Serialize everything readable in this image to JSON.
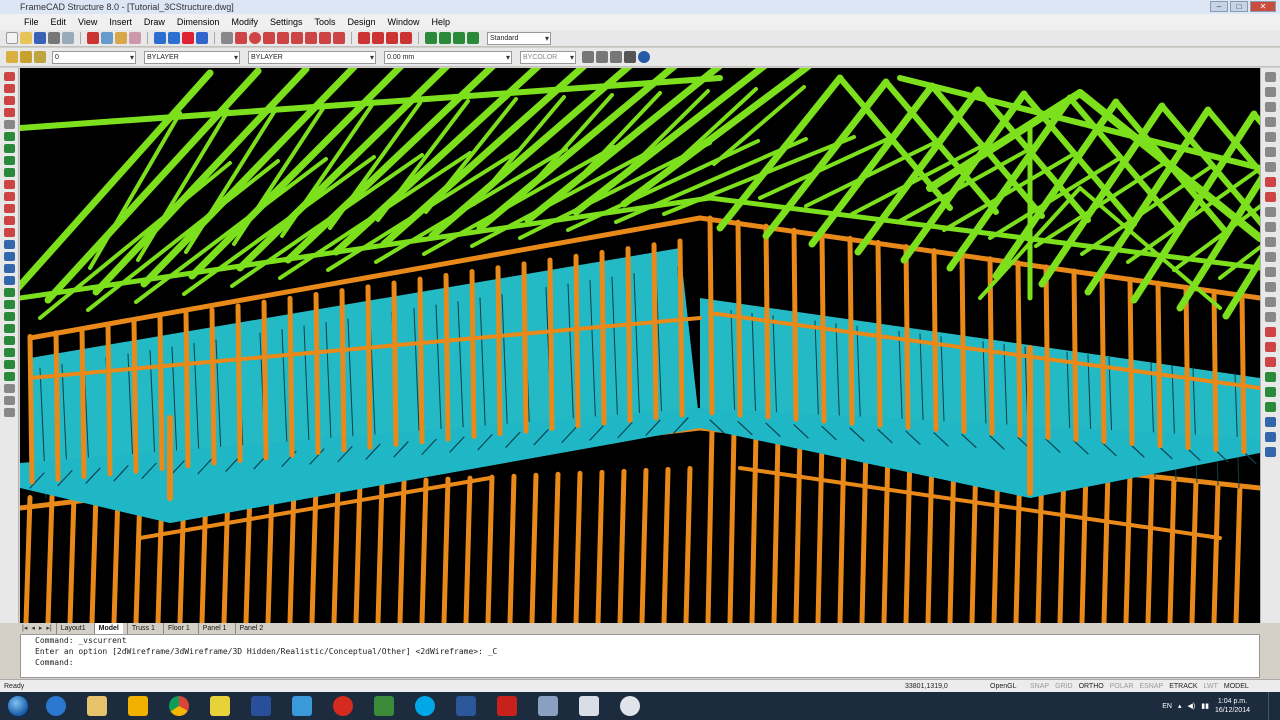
{
  "window": {
    "title": "FrameCAD Structure 8.0 - [Tutorial_3CStructure.dwg]"
  },
  "menu": [
    "File",
    "Edit",
    "View",
    "Insert",
    "Draw",
    "Dimension",
    "Modify",
    "Settings",
    "Tools",
    "Design",
    "Window",
    "Help"
  ],
  "toolbar": {
    "style_combo": "Standard",
    "layer_combo": "0",
    "color_combo": "BYLAYER",
    "linetype_combo": "BYLAYER",
    "lineweight_combo": "0.00 mm",
    "plotstyle_combo": "BYCOLOR"
  },
  "layout_tabs": [
    "Layout1",
    "Model",
    "Truss 1",
    "Floor 1",
    "Panel 1",
    "Panel 2"
  ],
  "active_tab": "Model",
  "command": {
    "line1": "Command: _vscurrent",
    "line2": "Enter an option [2dWireframe/3dWireframe/3D Hidden/Realistic/Conceptual/Other] <2dWireframe>: _C",
    "line3": "Command:"
  },
  "status": {
    "ready": "Ready",
    "coordinates": "33801,1319,0",
    "renderer": "OpenGL",
    "modes": [
      {
        "label": "SNAP",
        "on": false
      },
      {
        "label": "GRID",
        "on": false
      },
      {
        "label": "ORTHO",
        "on": true
      },
      {
        "label": "POLAR",
        "on": false
      },
      {
        "label": "ESNAP",
        "on": false
      },
      {
        "label": "ETRACK",
        "on": true
      },
      {
        "label": "LWT",
        "on": false
      },
      {
        "label": "MODEL",
        "on": true
      }
    ]
  },
  "taskbar": {
    "apps": [
      "internet-explorer",
      "file-explorer",
      "outlook",
      "chrome",
      "sticky-notes",
      "remote-app",
      "network-app",
      "acrobat",
      "skype",
      "word",
      "pdf-reader",
      "paint",
      "cmd",
      "framecad"
    ],
    "language": "EN",
    "time": "1:04 p.m.",
    "date": "16/12/2014"
  },
  "colors": {
    "roof_truss": "#7ce01c",
    "wall_frame": "#e8891a",
    "floor_joist": "#29d9e8",
    "viewport_bg": "#000000"
  }
}
